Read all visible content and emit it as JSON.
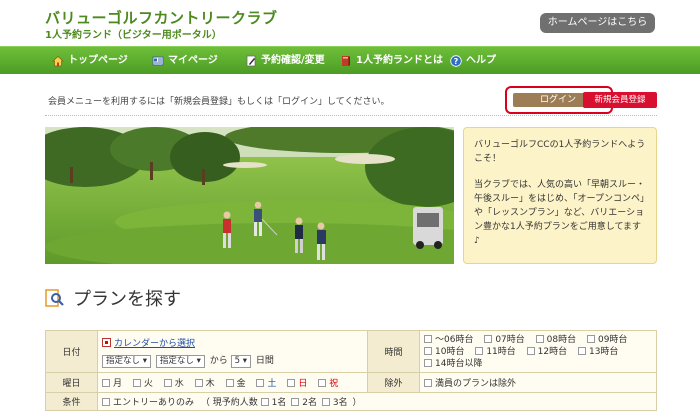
{
  "header": {
    "title": "バリューゴルフカントリークラブ",
    "subtitle": "1人予約ランド（ビジター用ポータル）",
    "home_button": "ホームページはこちら"
  },
  "nav": {
    "items": [
      {
        "label": "トップページ",
        "icon": "home-icon"
      },
      {
        "label": "マイページ",
        "icon": "mypage-icon"
      },
      {
        "label": "予約確認/変更",
        "icon": "pencil-icon"
      },
      {
        "label": "1人予約ランドとは",
        "icon": "book-icon"
      },
      {
        "label": "ヘルプ",
        "icon": "help-icon"
      }
    ]
  },
  "notice": {
    "text": "会員メニューを利用するには「新規会員登録」もしくは「ログイン」してください。",
    "login": "ログイン",
    "register": "新規会員登録"
  },
  "info": {
    "p1": "バリューゴルフCCの1人予約ランドへようこそ！",
    "p2": "当クラブでは、人気の高い「早朝スルー・午後スルー」をはじめ、「オープンコンペ」や「レッスンプラン」など、バリエーション豊かな1人予約プランをご用意してます♪"
  },
  "search": {
    "title": "プランを探す",
    "date_label": "日付",
    "calendar_link": "カレンダーから選択",
    "select_1": "指定なし",
    "select_2": "指定なし",
    "from_text": "から",
    "days_value": "5",
    "days_text": "日間",
    "time_label": "時間",
    "times": [
      "～06時台",
      "07時台",
      "08時台",
      "09時台",
      "10時台",
      "11時台",
      "12時台",
      "13時台",
      "14時台以降"
    ],
    "weekday_label": "曜日",
    "weekdays": [
      "月",
      "火",
      "水",
      "木",
      "金",
      "土",
      "日",
      "祝"
    ],
    "exclude_label": "除外",
    "exclude_text": "満員のプランは除外",
    "condition_label": "条件",
    "entry_text": "エントリーありのみ",
    "current_label": "（ 現予約人数",
    "counts": [
      "1名",
      "2名",
      "3名"
    ],
    "close_paren": "）"
  },
  "colors": {
    "brand_green": "#4c8a1e",
    "nav_green": "#5aab2d",
    "login_brown": "#9c7d55",
    "register_red": "#d90f2f",
    "highlight_red": "#d8001b"
  }
}
